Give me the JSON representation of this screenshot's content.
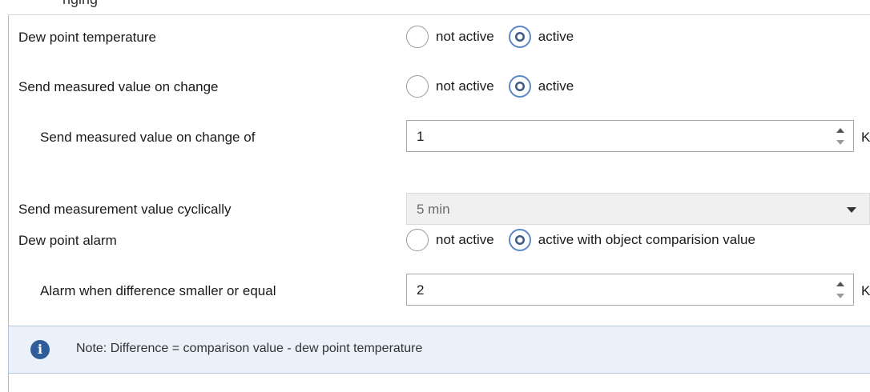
{
  "header_fragment": "nging",
  "rows": [
    {
      "label": "Dew point temperature",
      "options": [
        {
          "label": "not active",
          "checked": false
        },
        {
          "label": "active",
          "checked": true
        }
      ]
    },
    {
      "label": "Send measured value on change",
      "options": [
        {
          "label": "not active",
          "checked": false
        },
        {
          "label": "active",
          "checked": true
        }
      ]
    },
    {
      "label": "Send measured value on change of",
      "value": "1",
      "unit": "K"
    },
    {
      "label": "Send measurement value cyclically",
      "value": "5 min"
    },
    {
      "label": "Dew point alarm",
      "options": [
        {
          "label": "not active",
          "checked": false
        },
        {
          "label": "active with object comparision value",
          "checked": true
        }
      ]
    },
    {
      "label": "Alarm when difference smaller or equal",
      "value": "2",
      "unit": "K"
    }
  ],
  "note": {
    "icon": "info-icon",
    "text": "Note: Difference = comparison value - dew point temperature"
  },
  "colors": {
    "radio_checked": "#3d5a85",
    "note_background": "#eaf1f9",
    "info_icon": "#2e5d9a",
    "select_background": "#f0f0f0"
  }
}
